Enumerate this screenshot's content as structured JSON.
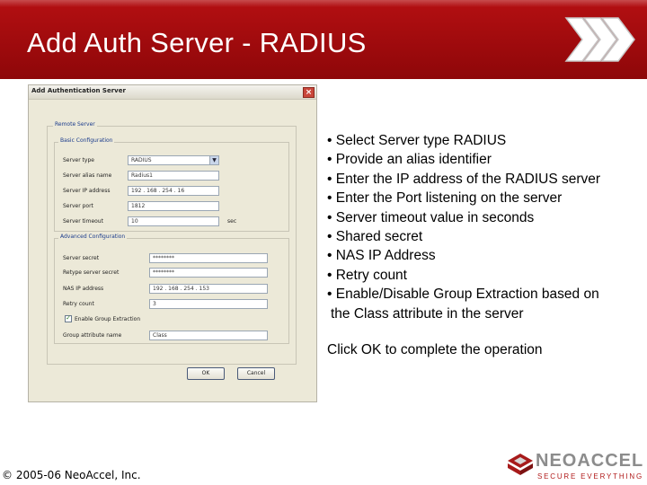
{
  "slide": {
    "title": "Add Auth Server - RADIUS"
  },
  "dialog": {
    "title": "Add Authentication Server",
    "close_icon": "close-icon",
    "remote_server_group": "Remote Server",
    "basic_group": "Basic Configuration",
    "advanced_group": "Advanced Configuration",
    "fields": {
      "server_type": {
        "label": "Server type",
        "value": "RADIUS"
      },
      "server_alias": {
        "label": "Server alias name",
        "value": "Radius1"
      },
      "server_ip": {
        "label": "Server IP address",
        "value": "192 . 168 . 254 . 16"
      },
      "server_port": {
        "label": "Server port",
        "value": "1812"
      },
      "server_timeout": {
        "label": "Server timeout",
        "value": "10",
        "unit": "sec"
      },
      "server_secret": {
        "label": "Server secret",
        "value": "********"
      },
      "retype_secret": {
        "label": "Retype server secret",
        "value": "********"
      },
      "nas_ip": {
        "label": "NAS IP address",
        "value": "192 . 168 . 254 . 153"
      },
      "retry_count": {
        "label": "Retry count",
        "value": "3"
      },
      "group_extraction": {
        "label": "Enable Group Extraction",
        "checked": true
      },
      "group_attribute": {
        "label": "Group attribute name",
        "value": "Class"
      }
    },
    "ok_label": "OK",
    "cancel_label": "Cancel"
  },
  "bullets": [
    "• Select Server type RADIUS",
    "• Provide an alias identifier",
    "• Enter the IP address of the RADIUS server",
    "• Enter the Port listening on the server",
    "• Server timeout value in seconds",
    "• Shared secret",
    "• NAS IP Address",
    "• Retry count",
    "• Enable/Disable Group Extraction based on",
    "the Class attribute in the server"
  ],
  "closing_note": "Click OK to complete the operation",
  "footer": {
    "copyright": "© 2005-06 NeoAccel, Inc.",
    "logo_name": "NEOACCEL",
    "logo_tagline": "SECURE EVERYTHING"
  },
  "colors": {
    "banner": "#a80c0f",
    "logo_red": "#b11b1b"
  },
  "icons": {
    "chevrons": "triple-chevron-right-icon",
    "logo": "neoaccel-logo-icon"
  }
}
